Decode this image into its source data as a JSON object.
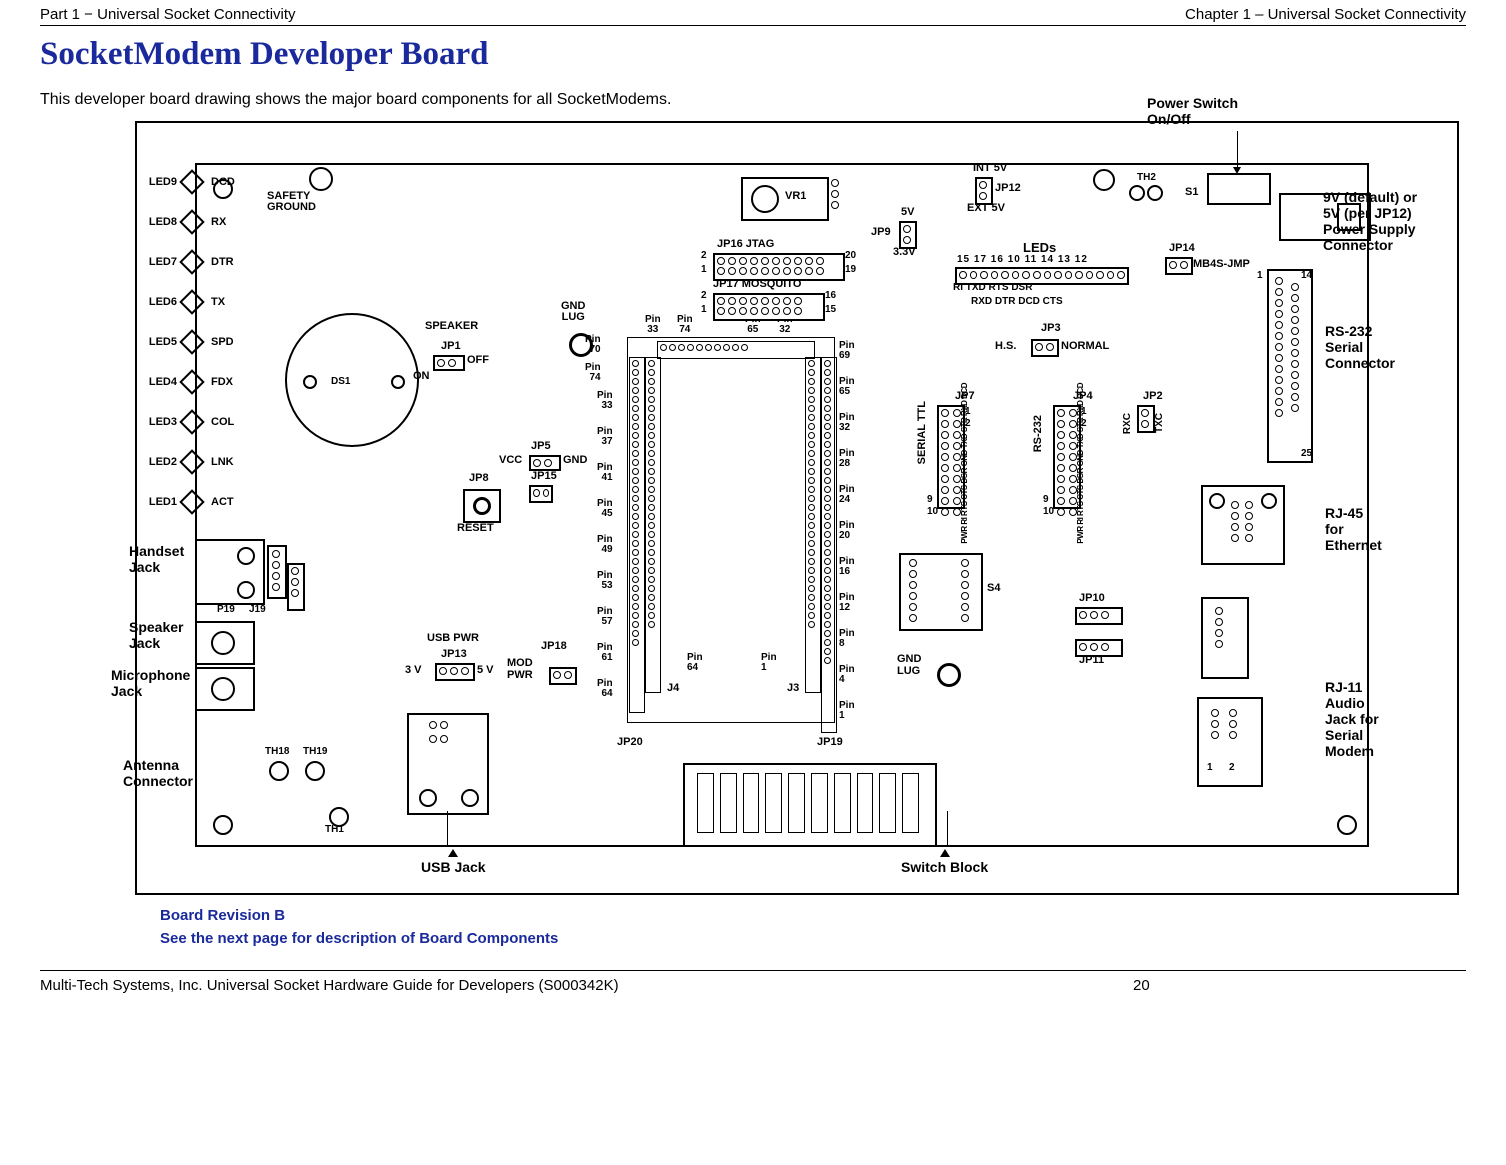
{
  "header": {
    "left": "Part 1 − Universal Socket Connectivity",
    "right": "Chapter 1 – Universal Socket Connectivity"
  },
  "title": "SocketModem Developer Board",
  "intro": "This developer board drawing shows the major board components for all SocketModems.",
  "caption": {
    "line1": "Board Revision B",
    "line2": "See the next page for description of Board Components"
  },
  "footer": {
    "text": "Multi-Tech Systems, Inc. Universal Socket Hardware Guide for Developers (S000342K)",
    "page": "20"
  },
  "callouts": {
    "power_switch": "Power Switch\nOn/Off",
    "psu": "9V (default) or\n5V (per JP12)\nPower Supply\nConnector",
    "rs232": "RS-232\nSerial\nConnector",
    "rj45": "RJ-45\nfor\nEthernet",
    "rj11": "RJ-11\nAudio\nJack for\nSerial\nModem",
    "switch_block": "Switch Block",
    "usb_jack": "USB Jack",
    "handset": "Handset\nJack",
    "speaker_jack": "Speaker\nJack",
    "mic_jack": "Microphone\nJack",
    "antenna": "Antenna\nConnector"
  },
  "labels": {
    "leds": [
      "LED9",
      "LED8",
      "LED7",
      "LED6",
      "LED5",
      "LED4",
      "LED3",
      "LED2",
      "LED1"
    ],
    "led_sigs": [
      "DCD",
      "RX",
      "DTR",
      "TX",
      "SPD",
      "FDX",
      "COL",
      "LNK",
      "ACT"
    ],
    "safety": "SAFETY\nGROUND",
    "speaker": "SPEAKER",
    "ds1": "DS1",
    "jp1": "JP1",
    "on": "ON",
    "off": "OFF",
    "jp8": "JP8",
    "jp5": "JP5",
    "jp15": "JP15",
    "vcc": "VCC",
    "gnd": "GND",
    "reset": "RESET",
    "p19": "P19",
    "j19": "J19",
    "usb_pwr": "USB PWR",
    "jp13": "JP13",
    "v3": "3 V",
    "v5": "5 V",
    "jp18": "JP18",
    "mod_pwr": "MOD\nPWR",
    "gnd_lug": "GND\nLUG",
    "jp16": "JP16  JTAG",
    "jp17": "JP17 MOSQUITO",
    "jp20": "JP20",
    "jp19": "JP19",
    "j4": "J4",
    "j3": "J3",
    "vr1": "VR1",
    "jp9": "JP9",
    "v5a": "5V",
    "v33": "3.3V",
    "jp12": "JP12",
    "int5v": "INT 5V",
    "ext5v": "EXT 5V",
    "leds_hdr": "LEDs",
    "led_top_nums": "15 17 16 10 11 14 13 12",
    "led_top_sigs_l": "RI     TXD    RTS   DSR",
    "led_top_sigs_r": "RXD   DTR   DCD   CTS",
    "jp14": "JP14",
    "mb4s": "MB4S-JMP",
    "jp3": "JP3",
    "hs": "H.S.",
    "normal": "NORMAL",
    "serial_ttl": "SERIAL TTL",
    "rs232v": "RS-232",
    "jp7": "JP7",
    "jp4": "JP4",
    "jp2": "JP2",
    "strip_sigs": "PWR RI RTS CTS DSR GND TXD STR RXD DCD",
    "strip_sigs2": "PWR RI RTS CTS DSR GND TXD STR RXD DCD",
    "rxc": "RXC",
    "txc": "TXC",
    "gnd_lug2": "GND\nLUG",
    "s4": "S4",
    "jp10": "JP10",
    "jp11": "JP11",
    "s1": "S1",
    "th2": "TH2",
    "th18": "TH18",
    "th19": "TH19",
    "th1": "TH1",
    "pins_left": [
      "Pin\n70",
      "Pin\n74",
      "Pin\n33",
      "Pin\n37",
      "Pin\n41",
      "Pin\n45",
      "Pin\n49",
      "Pin\n53",
      "Pin\n57",
      "Pin\n61",
      "Pin\n64"
    ],
    "pins_top": [
      "Pin\n33",
      "Pin\n74",
      "Pin\n65",
      "Pin\n32"
    ],
    "pins_right": [
      "Pin\n69",
      "Pin\n65",
      "Pin\n32",
      "Pin\n28",
      "Pin\n24",
      "Pin\n20",
      "Pin\n16",
      "Pin\n12",
      "Pin\n8",
      "Pin\n4",
      "Pin\n1"
    ],
    "pin64b": "Pin\n64",
    "pin1b": "Pin\n1",
    "n1": "1",
    "n2": "2",
    "n19": "19",
    "n20": "20",
    "n15": "15",
    "n16": "16",
    "n9": "9",
    "n10": "10",
    "n12": "12",
    "n14": "14",
    "n25": "25"
  }
}
